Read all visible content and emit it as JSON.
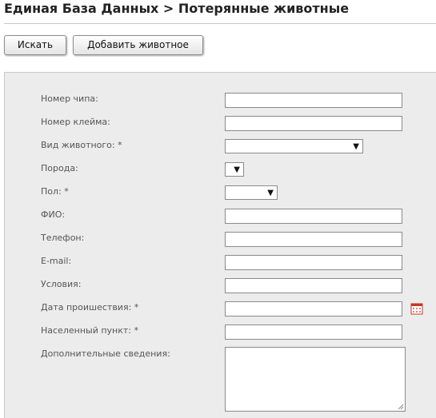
{
  "page": {
    "title": "Единая База Данных > Потерянные животные"
  },
  "toolbar": {
    "search_label": "Искать",
    "add_label": "Добавить животное"
  },
  "form": {
    "chip_label": "Номер чипа:",
    "chip_value": "",
    "brand_label": "Номер клейма:",
    "brand_value": "",
    "species_label": "Вид животного: *",
    "species_selected": "",
    "breed_label": "Порода:",
    "breed_selected": "",
    "sex_label": "Пол: *",
    "sex_selected": "",
    "name_label": "ФИО:",
    "name_value": "",
    "phone_label": "Телефон:",
    "phone_value": "",
    "email_label": "E-mail:",
    "email_value": "",
    "conditions_label": "Условия:",
    "conditions_value": "",
    "date_label": "Дата проишествия: *",
    "date_value": "",
    "city_label": "Населенный пункт: *",
    "city_value": "",
    "notes_label": "Дополнительные сведения:",
    "notes_value": ""
  },
  "icons": {
    "dropdown": "▼",
    "calendar": "calendar-icon"
  },
  "colors": {
    "panel_bg": "#ececec",
    "calendar_accent": "#c0392b"
  }
}
